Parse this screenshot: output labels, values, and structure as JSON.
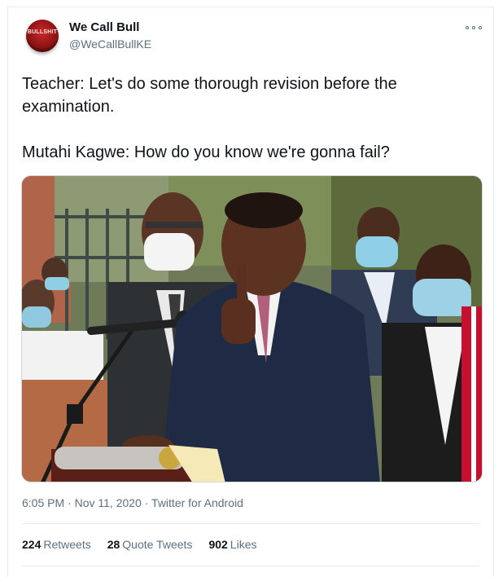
{
  "tweet": {
    "display_name": "We Call Bull",
    "handle": "@WeCallBullKE",
    "avatar_text": "BULLSHIT",
    "text_lines": [
      "Teacher: Let's do some thorough revision before the examination.",
      "Mutahi Kagwe: How do you know we're gonna fail?"
    ],
    "time": "6:05 PM",
    "date": "Nov 11, 2020",
    "source": "Twitter for Android"
  },
  "stats": {
    "retweets_count": "224",
    "retweets_label": "Retweets",
    "quote_count": "28",
    "quote_label": "Quote Tweets",
    "likes_count": "902",
    "likes_label": "Likes"
  },
  "icons": {
    "more": "more-options-icon"
  }
}
